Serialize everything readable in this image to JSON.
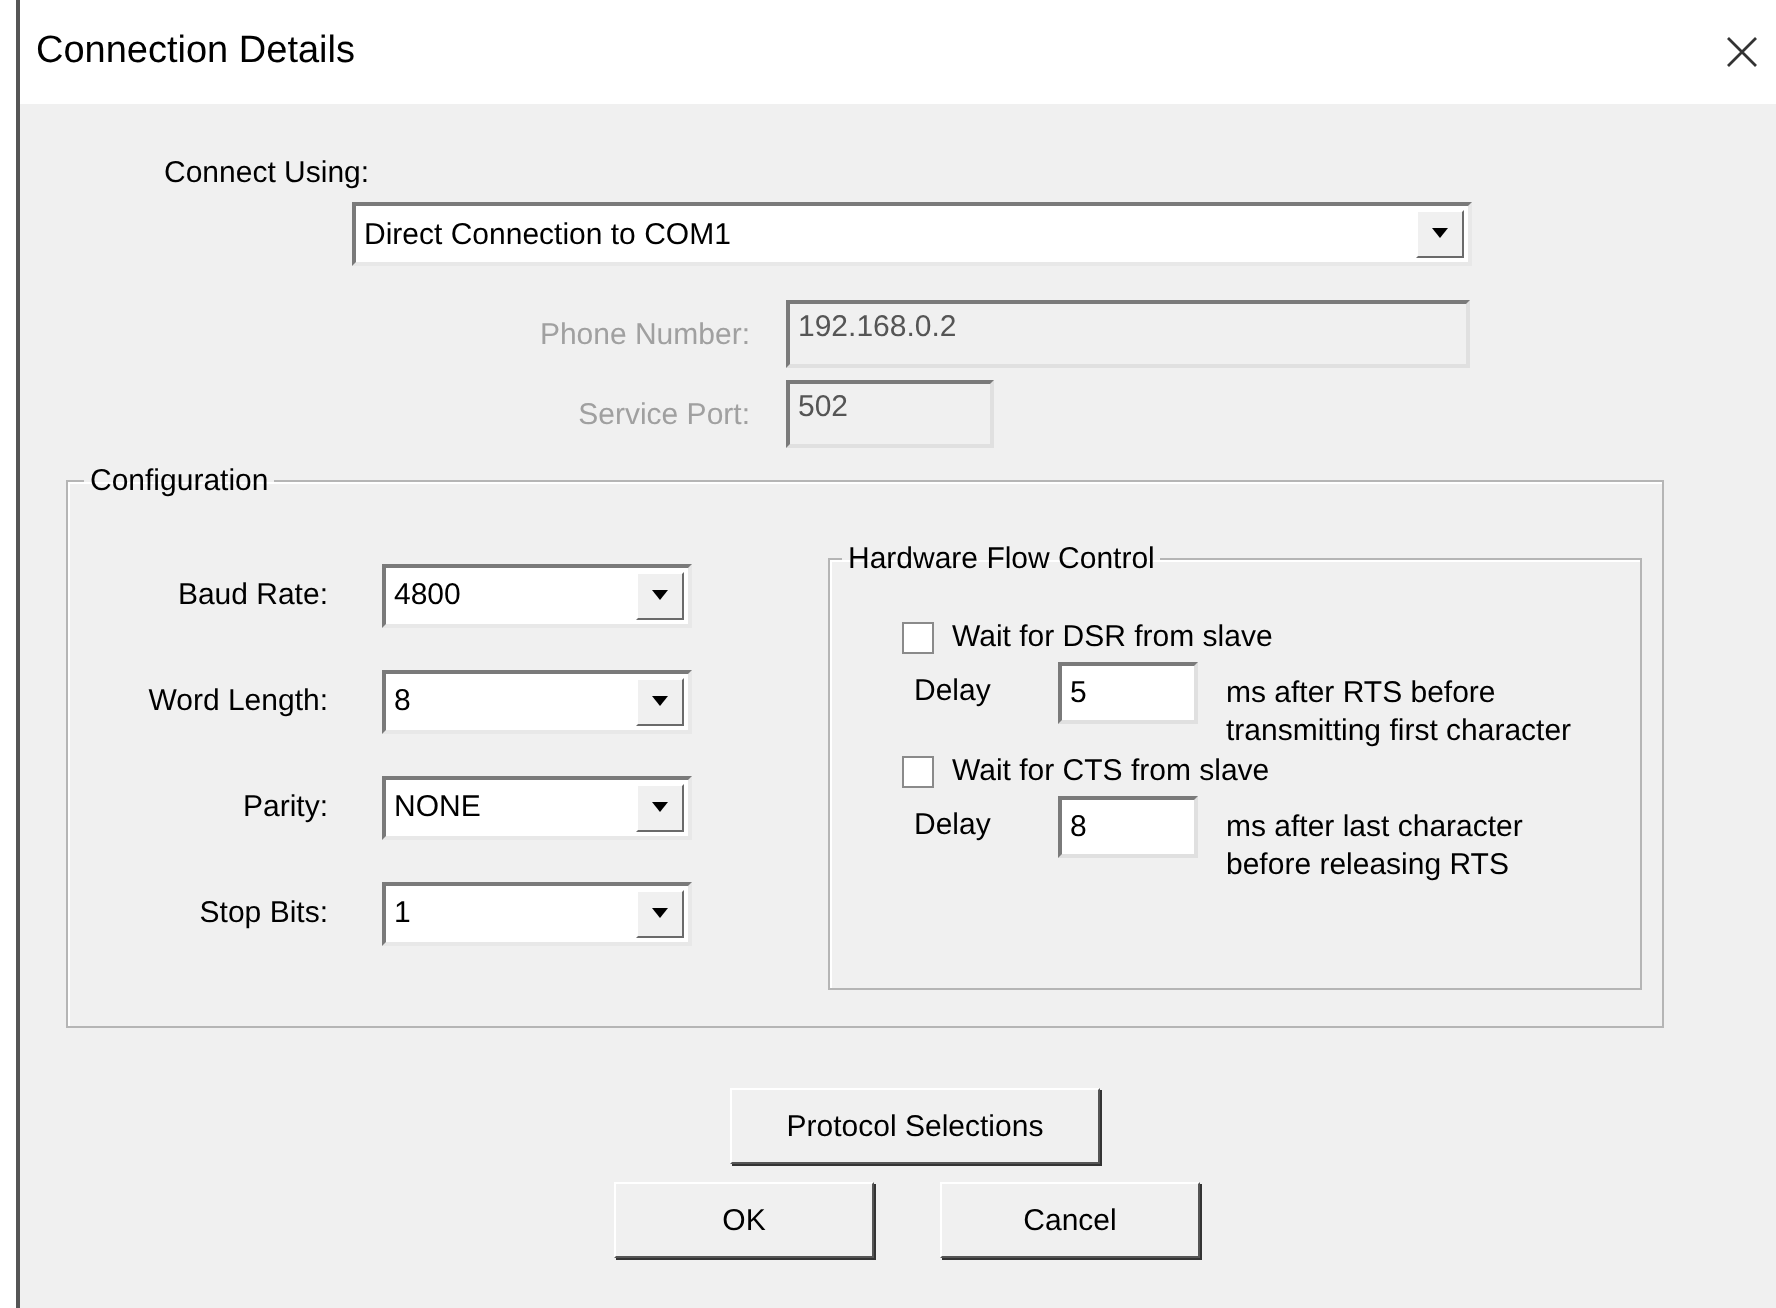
{
  "window": {
    "title": "Connection Details"
  },
  "connect_using": {
    "label": "Connect Using:",
    "value": "Direct Connection to COM1"
  },
  "address_fields": [
    {
      "label": "Phone Number:",
      "value": "192.168.0.2",
      "disabled": true
    },
    {
      "label": "Service Port:",
      "value": "502",
      "disabled": true
    }
  ],
  "configuration": {
    "title": "Configuration",
    "fields": [
      {
        "label": "Baud Rate:",
        "value": "4800"
      },
      {
        "label": "Word Length:",
        "value": "8"
      },
      {
        "label": "Parity:",
        "value": "NONE"
      },
      {
        "label": "Stop Bits:",
        "value": "1"
      }
    ]
  },
  "hardware_flow_control": {
    "title": "Hardware Flow Control",
    "options": [
      {
        "label": "Wait for DSR from slave",
        "checked": false,
        "delay_label": "Delay",
        "delay": "5",
        "note": [
          "ms after RTS before",
          "transmitting first character"
        ]
      },
      {
        "label": "Wait for CTS from slave",
        "checked": false,
        "delay_label": "Delay",
        "delay": "8",
        "note": [
          "ms after last character",
          "before releasing RTS"
        ]
      }
    ]
  },
  "buttons": {
    "protocol": "Protocol Selections",
    "ok": "OK",
    "cancel": "Cancel"
  }
}
